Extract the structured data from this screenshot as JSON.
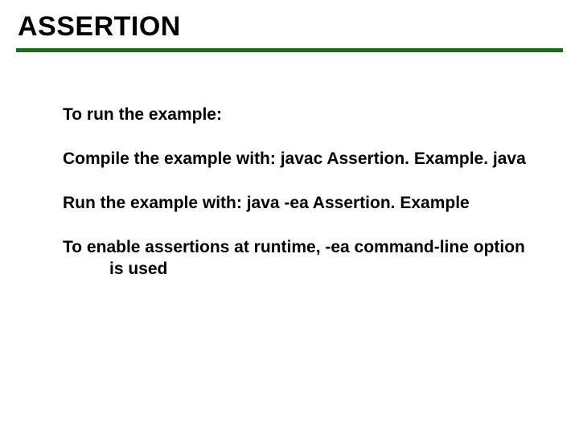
{
  "title": "ASSERTION",
  "paragraphs": {
    "p1": "To run the example:",
    "p2": "Compile the example with:  javac Assertion. Example. java",
    "p3": "Run the example with:  java -ea Assertion. Example",
    "p4": "To enable assertions at runtime,  -ea command-line option is used"
  }
}
